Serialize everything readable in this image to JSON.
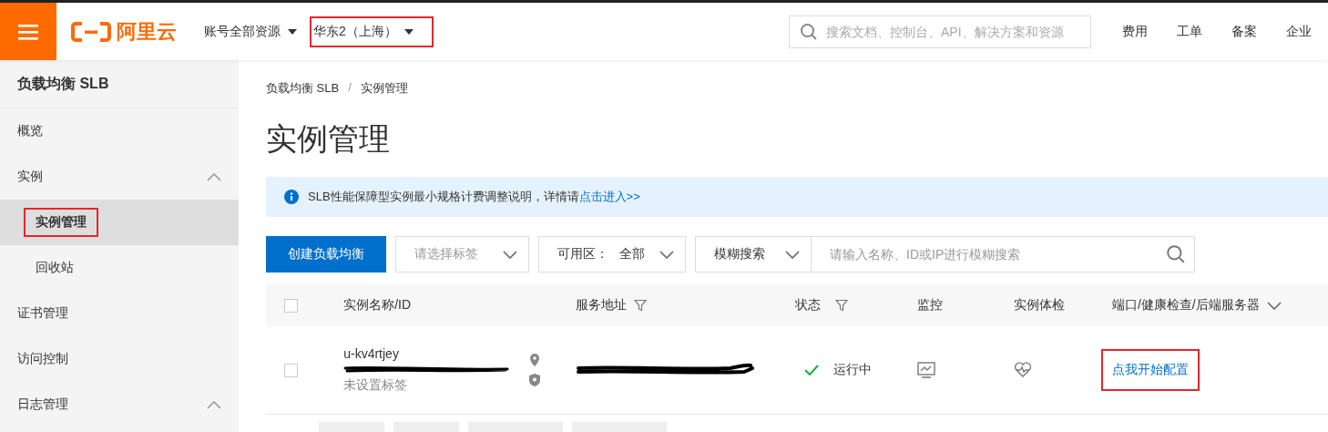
{
  "header": {
    "brand": "阿里云",
    "account_menu": "账号全部资源",
    "region": {
      "label": "华东2（上海）",
      "highlighted": true
    },
    "search": {
      "placeholder": "搜索文档、控制台、API、解决方案和资源"
    },
    "nav": [
      "费用",
      "工单",
      "备案",
      "企业"
    ]
  },
  "sidebar": {
    "title": "负载均衡 SLB",
    "items": [
      {
        "label": "概览",
        "selected": false
      },
      {
        "label": "实例",
        "selected": false,
        "expanded": true,
        "children": [
          {
            "label": "实例管理",
            "selected": true,
            "highlighted": true
          },
          {
            "label": "回收站",
            "selected": false,
            "highlighted": false
          }
        ]
      },
      {
        "label": "证书管理",
        "selected": false
      },
      {
        "label": "访问控制",
        "selected": false
      },
      {
        "label": "日志管理",
        "selected": false,
        "expanded": true
      }
    ]
  },
  "breadcrumb": [
    "负载均衡 SLB",
    "实例管理"
  ],
  "breadcrumb_separator": "/",
  "page_title": "实例管理",
  "notice": {
    "text": "SLB性能保障型实例最小规格计费调整说明，详情请",
    "link": "点击进入>>"
  },
  "toolbar": {
    "create_button": "创建负载均衡",
    "tag_select": {
      "placeholder": "请选择标签"
    },
    "zone_select": {
      "label": "可用区：",
      "value": "全部"
    },
    "search_mode": "模糊搜索",
    "search": {
      "placeholder": "请输入名称、ID或IP进行模糊搜索"
    }
  },
  "table": {
    "select_all": {
      "checked": false
    },
    "columns": [
      {
        "label": "实例名称/ID",
        "filter": false
      },
      {
        "label": "服务地址",
        "filter": true
      },
      {
        "label": "状态",
        "filter": true
      },
      {
        "label": "监控",
        "filter": false
      },
      {
        "label": "实例体检",
        "filter": false
      },
      {
        "label": "端口/健康检查/后端服务器",
        "filter": false,
        "dropdown": true
      }
    ],
    "rows": [
      {
        "checked": false,
        "name": "u-kv4rtjey",
        "id_redacted": true,
        "tag": "未设置标签",
        "address_redacted": true,
        "status": "运行中",
        "config_link": {
          "label": "点我开始配置",
          "highlighted": true
        }
      }
    ]
  }
}
